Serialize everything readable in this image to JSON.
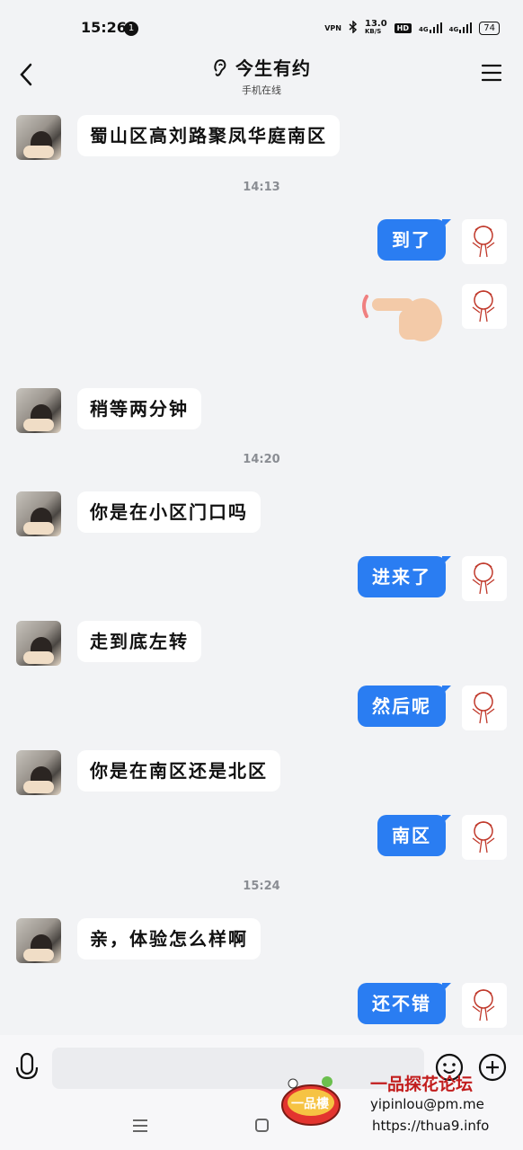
{
  "status": {
    "time": "15:26",
    "notification_count": "1",
    "speed": "13.0",
    "speed_unit": "KB/S",
    "hd": "HD",
    "net1": "4G",
    "net2": "4G",
    "battery": "74",
    "vpn": "VPN"
  },
  "header": {
    "title": "今生有约",
    "subtitle": "手机在线"
  },
  "messages": [
    {
      "side": "left",
      "text": "蜀山区高刘路聚凤华庭南区"
    },
    {
      "side": "time",
      "text": "14:13"
    },
    {
      "side": "right",
      "text": "到了"
    },
    {
      "side": "right",
      "text": "👉"
    },
    {
      "side": "left",
      "text": "稍等两分钟"
    },
    {
      "side": "time",
      "text": "14:20"
    },
    {
      "side": "left",
      "text": "你是在小区门口吗"
    },
    {
      "side": "right",
      "text": "进来了"
    },
    {
      "side": "left",
      "text": "走到底左转"
    },
    {
      "side": "right",
      "text": "然后呢"
    },
    {
      "side": "left",
      "text": "你是在南区还是北区"
    },
    {
      "side": "right",
      "text": "南区"
    },
    {
      "side": "time",
      "text": "15:24"
    },
    {
      "side": "left",
      "text": "亲，体验怎么样啊"
    },
    {
      "side": "right",
      "text": "还不错"
    }
  ],
  "input": {
    "placeholder": ""
  },
  "icons": {
    "voice": "microphone-icon",
    "emoji": "smiley-icon",
    "add": "plus-circle-icon",
    "back": "chevron-left-icon",
    "menu": "hamburger-icon"
  },
  "watermark": {
    "logo_text": "一品樓",
    "title": "一品探花论坛",
    "email": "yipinlou@pm.me",
    "url": "https://thua9.info"
  },
  "colors": {
    "accent": "#2a7df2",
    "background": "#f2f3f5",
    "watermark_red": "#c21d1d"
  }
}
